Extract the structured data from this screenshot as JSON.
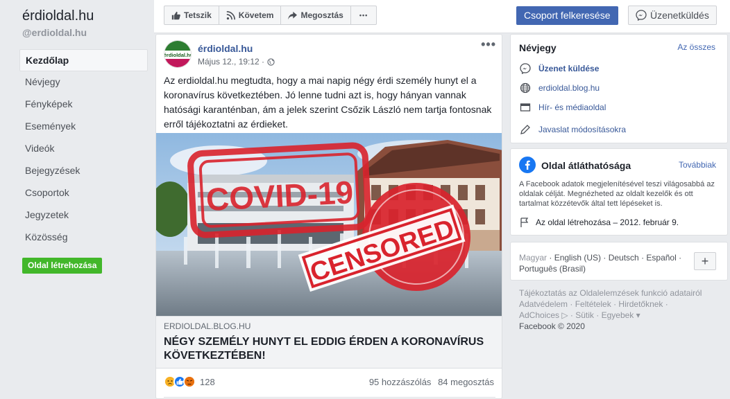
{
  "sidebar": {
    "page_name": "érdioldal.hu",
    "handle": "@erdioldal.hu",
    "items": [
      {
        "label": "Kezdőlap"
      },
      {
        "label": "Névjegy"
      },
      {
        "label": "Fényképek"
      },
      {
        "label": "Események"
      },
      {
        "label": "Videók"
      },
      {
        "label": "Bejegyzések"
      },
      {
        "label": "Csoportok"
      },
      {
        "label": "Jegyzetek"
      },
      {
        "label": "Közösség"
      }
    ],
    "create_page": "Oldal létrehozása"
  },
  "topbar": {
    "like": "Tetszik",
    "follow": "Követem",
    "share": "Megosztás",
    "more": "•••",
    "find_group": "Csoport felkeresése",
    "message": "Üzenetküldés"
  },
  "post": {
    "author": "érdioldal.hu",
    "time": "Május 12., 19:12 ·",
    "more": "•••",
    "text": "Az erdioldal.hu megtudta, hogy a mai napig négy érdi személy hunyt el a koronavírus következtében. Jó lenne tudni azt is, hogy hányan vannak hatósági karanténban, ám a jelek szerint Csőzik László nem tartja fontosnak erről tájékoztatni az érdieket.",
    "image": {
      "stamp_covid": "COVID-19",
      "stamp_censored": "CENSORED"
    },
    "avatar_logo": "érdioldal.hu",
    "link": {
      "domain": "ERDIOLDAL.BLOG.HU",
      "title": "NÉGY SZEMÉLY HUNYT EL EDDIG ÉRDEN A KORONAVÍRUS KÖVETKEZTÉBEN!"
    },
    "reaction_count": "128",
    "comments": "95 hozzászólás",
    "shares": "84 megosztás"
  },
  "about": {
    "title": "Névjegy",
    "see_all": "Az összes",
    "message": "Üzenet küldése",
    "website": "erdioldal.blog.hu",
    "category": "Hír- és médiaoldal",
    "suggest": "Javaslat módosításokra"
  },
  "transparency": {
    "title": "Oldal átláthatósága",
    "more": "Továbbiak",
    "text": "A Facebook adatok megjelenítésével teszi világosabbá az oldalak célját. Megnézheted az oldalt kezelők és ott tartalmat közzétevők által tett lépéseket is.",
    "created": "Az oldal létrehozása – 2012. február 9."
  },
  "languages": {
    "current": "Magyar",
    "list": "· English (US) · Deutsch · Español · Português (Brasil)",
    "plus": "+"
  },
  "footer": {
    "line1": "Tájékoztatás az Oldalelemzések funkció adatairól",
    "line2": "Adatvédelem · Feltételek · Hirdetőknek ·",
    "line3": "AdChoices ▷ · Sütik · Egyebek ▾",
    "copyright": "Facebook © 2020"
  },
  "colors": {
    "fb_blue": "#4267b2",
    "link_blue": "#385898",
    "green": "#42b72a",
    "stamp_red": "#d9232d"
  }
}
